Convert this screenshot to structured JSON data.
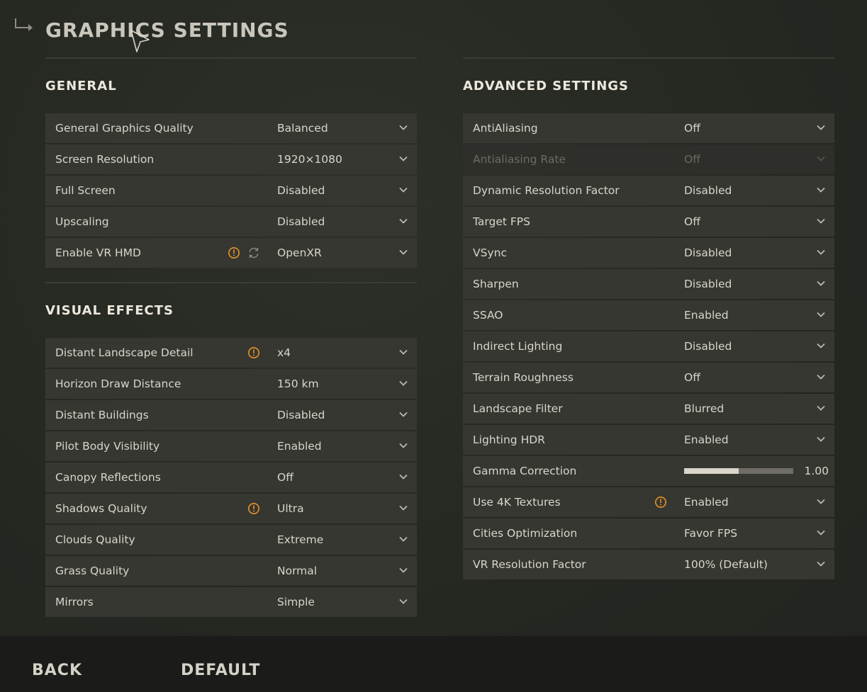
{
  "page": {
    "title": "GRAPHICS SETTINGS"
  },
  "colors": {
    "background": "#262823",
    "row_background": "#363731",
    "warning": "#e8922a",
    "text": "#d8d5cb",
    "footer": "#1b1c19"
  },
  "general": {
    "title": "GENERAL",
    "rows": [
      {
        "label": "General Graphics Quality",
        "value": "Balanced"
      },
      {
        "label": "Screen Resolution",
        "value": "1920×1080"
      },
      {
        "label": "Full Screen",
        "value": "Disabled"
      },
      {
        "label": "Upscaling",
        "value": "Disabled"
      },
      {
        "label": "Enable VR HMD",
        "value": "OpenXR",
        "icons": [
          "warning-icon",
          "sync-icon"
        ]
      }
    ]
  },
  "visual_effects": {
    "title": "VISUAL EFFECTS",
    "rows": [
      {
        "label": "Distant Landscape Detail",
        "value": "x4",
        "icons": [
          "warning-icon"
        ]
      },
      {
        "label": "Horizon Draw Distance",
        "value": "150 km"
      },
      {
        "label": "Distant Buildings",
        "value": "Disabled"
      },
      {
        "label": "Pilot Body Visibility",
        "value": "Enabled"
      },
      {
        "label": "Canopy Reflections",
        "value": "Off"
      },
      {
        "label": "Shadows Quality",
        "value": "Ultra",
        "icons": [
          "warning-icon"
        ]
      },
      {
        "label": "Clouds Quality",
        "value": "Extreme"
      },
      {
        "label": "Grass Quality",
        "value": "Normal"
      },
      {
        "label": "Mirrors",
        "value": "Simple"
      }
    ]
  },
  "advanced": {
    "title": "ADVANCED SETTINGS",
    "rows": [
      {
        "label": "AntiAliasing",
        "value": "Off"
      },
      {
        "label": "Antialiasing Rate",
        "value": "Off",
        "disabled": true
      },
      {
        "label": "Dynamic Resolution Factor",
        "value": "Disabled"
      },
      {
        "label": "Target FPS",
        "value": "Off"
      },
      {
        "label": "VSync",
        "value": "Disabled"
      },
      {
        "label": "Sharpen",
        "value": "Disabled"
      },
      {
        "label": "SSAO",
        "value": "Enabled"
      },
      {
        "label": "Indirect Lighting",
        "value": "Disabled"
      },
      {
        "label": "Terrain Roughness",
        "value": "Off"
      },
      {
        "label": "Landscape Filter",
        "value": "Blurred"
      },
      {
        "label": "Lighting HDR",
        "value": "Enabled"
      },
      {
        "label": "Gamma Correction",
        "value": "1.00",
        "slider_fraction": 0.5
      },
      {
        "label": "Use 4K Textures",
        "value": "Enabled",
        "icons": [
          "warning-icon"
        ]
      },
      {
        "label": "Cities Optimization",
        "value": "Favor FPS"
      },
      {
        "label": "VR Resolution Factor",
        "value": "100% (Default)"
      }
    ]
  },
  "footer": {
    "back_label": "BACK",
    "default_label": "DEFAULT"
  }
}
